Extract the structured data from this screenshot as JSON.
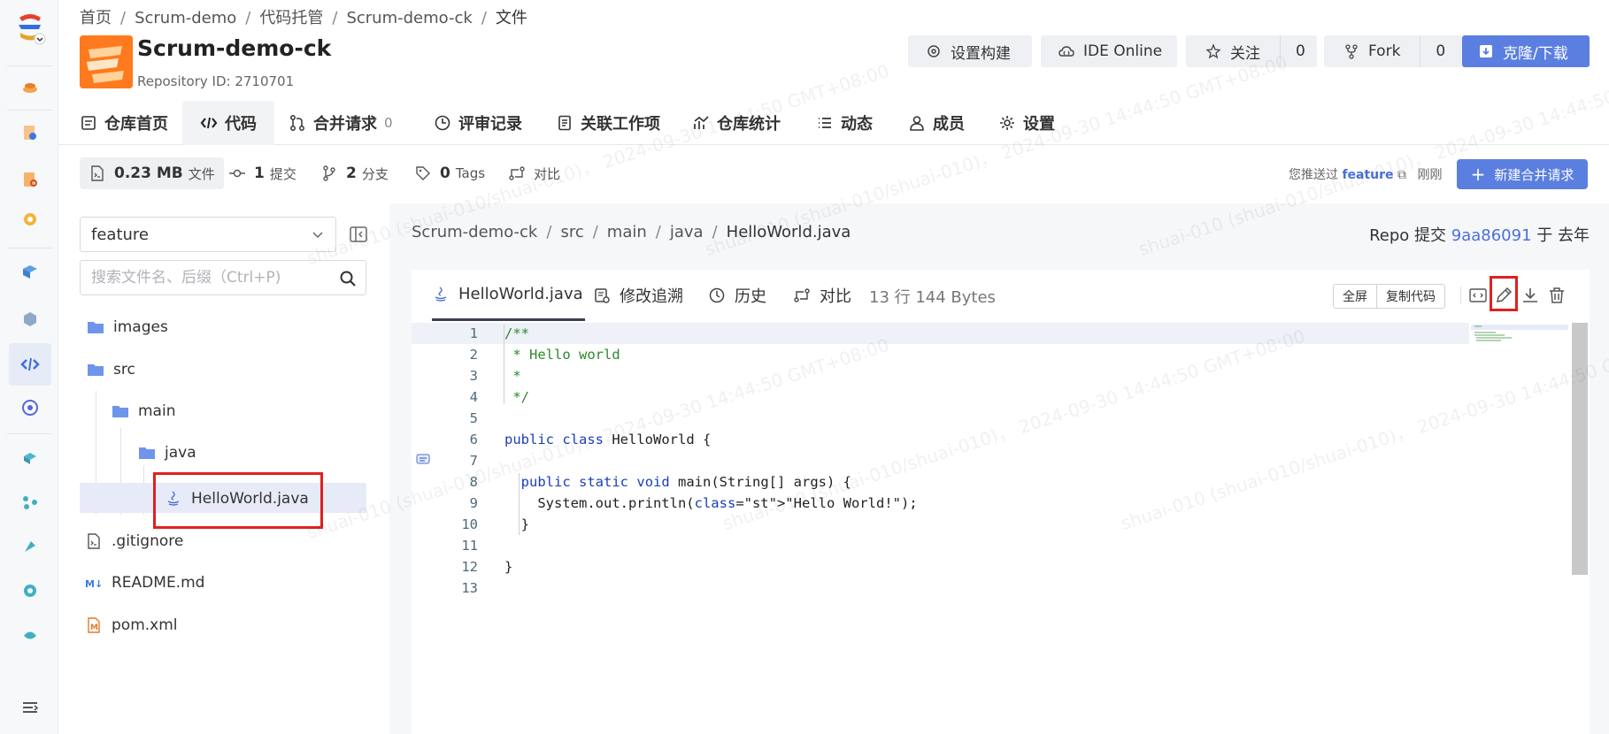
{
  "breadcrumb": [
    "首页",
    "Scrum-demo",
    "代码托管",
    "Scrum-demo-ck",
    "文件"
  ],
  "repo": {
    "name": "Scrum-demo-ck",
    "id_text": "Repository ID: 2710701"
  },
  "header_buttons": {
    "settings_build": "设置构建",
    "ide_online": "IDE Online",
    "watch": "关注",
    "watch_count": "0",
    "fork": "Fork",
    "fork_count": "0",
    "clone": "克隆/下载"
  },
  "tabs": [
    {
      "label": "仓库首页",
      "icon": "doc-icon"
    },
    {
      "label": "代码",
      "icon": "code-icon",
      "active": true
    },
    {
      "label": "合并请求",
      "icon": "merge-icon",
      "badge": "0"
    },
    {
      "label": "评审记录",
      "icon": "clock-icon"
    },
    {
      "label": "关联工作项",
      "icon": "list-doc-icon"
    },
    {
      "label": "仓库统计",
      "icon": "chart-icon"
    },
    {
      "label": "动态",
      "icon": "feed-icon"
    },
    {
      "label": "成员",
      "icon": "user-icon"
    },
    {
      "label": "设置",
      "icon": "gear-icon"
    }
  ],
  "stats": {
    "size_value": "0.23 MB",
    "size_label": "文件",
    "commits_value": "1",
    "commits_label": "提交",
    "branches_value": "2",
    "branches_label": "分支",
    "tags_value": "0",
    "tags_label": "Tags",
    "compare_label": "对比"
  },
  "push_info": {
    "prefix": "您推送过",
    "branch": "feature",
    "time": "刚刚"
  },
  "new_mr_button": "新建合并请求",
  "sidebar": {
    "branch": "feature",
    "search_placeholder": "搜索文件名、后缀（Ctrl+P)",
    "tree": [
      {
        "name": "images",
        "type": "folder"
      },
      {
        "name": "src",
        "type": "folder"
      },
      {
        "name": "main",
        "type": "folder"
      },
      {
        "name": "java",
        "type": "folder"
      },
      {
        "name": "HelloWorld.java",
        "type": "java",
        "selected": true
      },
      {
        "name": ".gitignore",
        "type": "file"
      },
      {
        "name": "README.md",
        "type": "markdown"
      },
      {
        "name": "pom.xml",
        "type": "maven"
      }
    ]
  },
  "file_path": [
    "Scrum-demo-ck",
    "src",
    "main",
    "java",
    "HelloWorld.java"
  ],
  "commit_info": {
    "prefix": "Repo 提交",
    "hash": "9aa86091",
    "suffix": "于 去年"
  },
  "file_tabs": {
    "file": "HelloWorld.java",
    "blame": "修改追溯",
    "history": "历史",
    "compare": "对比",
    "meta": "13 行  144 Bytes"
  },
  "file_actions": {
    "fullscreen": "全屏",
    "copy": "复制代码"
  },
  "code_lines": [
    "/**",
    " * Hello world",
    " *",
    " */",
    "",
    "public class HelloWorld {",
    "",
    "  public static void main(String[] args) {",
    "    System.out.println(\"Hello World!\");",
    "  }",
    "",
    "}",
    ""
  ],
  "line_numbers": [
    "1",
    "2",
    "3",
    "4",
    "5",
    "6",
    "7",
    "8",
    "9",
    "10",
    "11",
    "12",
    "13"
  ],
  "watermark": [
    "shuai-010 (shuai-010/shuai-010)，",
    "2024-09-30 14:44:50 GMT+08:00"
  ],
  "colors": {
    "accent": "#5b7fe0",
    "link": "#4a6fd8",
    "highlight_box": "#e02020"
  }
}
